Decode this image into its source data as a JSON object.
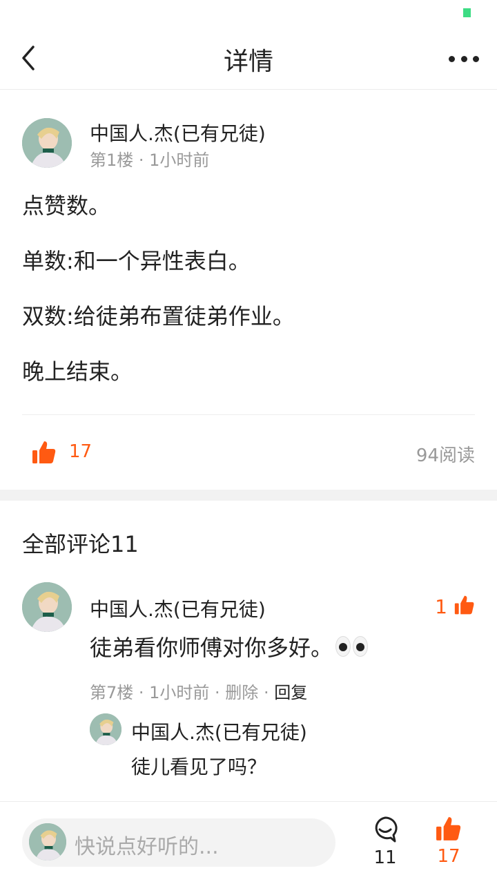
{
  "nav": {
    "title": "详情"
  },
  "post": {
    "author": "中国人.杰(已有兄徒)",
    "meta": "第1楼 · 1小时前",
    "lines": [
      "点赞数。",
      "单数:和一个异性表白。",
      "双数:给徒弟布置徒弟作业。",
      "晚上结束。"
    ],
    "like_count": "17",
    "read_count": "94阅读"
  },
  "comments_header": "全部评论11",
  "comment": {
    "author": "中国人.杰(已有兄徒)",
    "like_count": "1",
    "text": "徒弟看你师傅对你多好。",
    "meta_prefix": "第7楼 · 1小时前 · 删除 · ",
    "reply_label": "回复",
    "reply": {
      "author": "中国人.杰(已有兄徒)",
      "text": "徒儿看见了吗？"
    }
  },
  "bottom_bar": {
    "placeholder": "快说点好听的...",
    "comment_count": "11",
    "like_count": "17"
  },
  "colors": {
    "accent": "#ff5a12",
    "status_green": "#3ddc84",
    "muted": "#999999"
  },
  "icons": [
    "back-arrow-icon",
    "more-dots-icon",
    "thumbs-up-icon",
    "comment-bubble-icon",
    "eyes-emoji-icon"
  ]
}
